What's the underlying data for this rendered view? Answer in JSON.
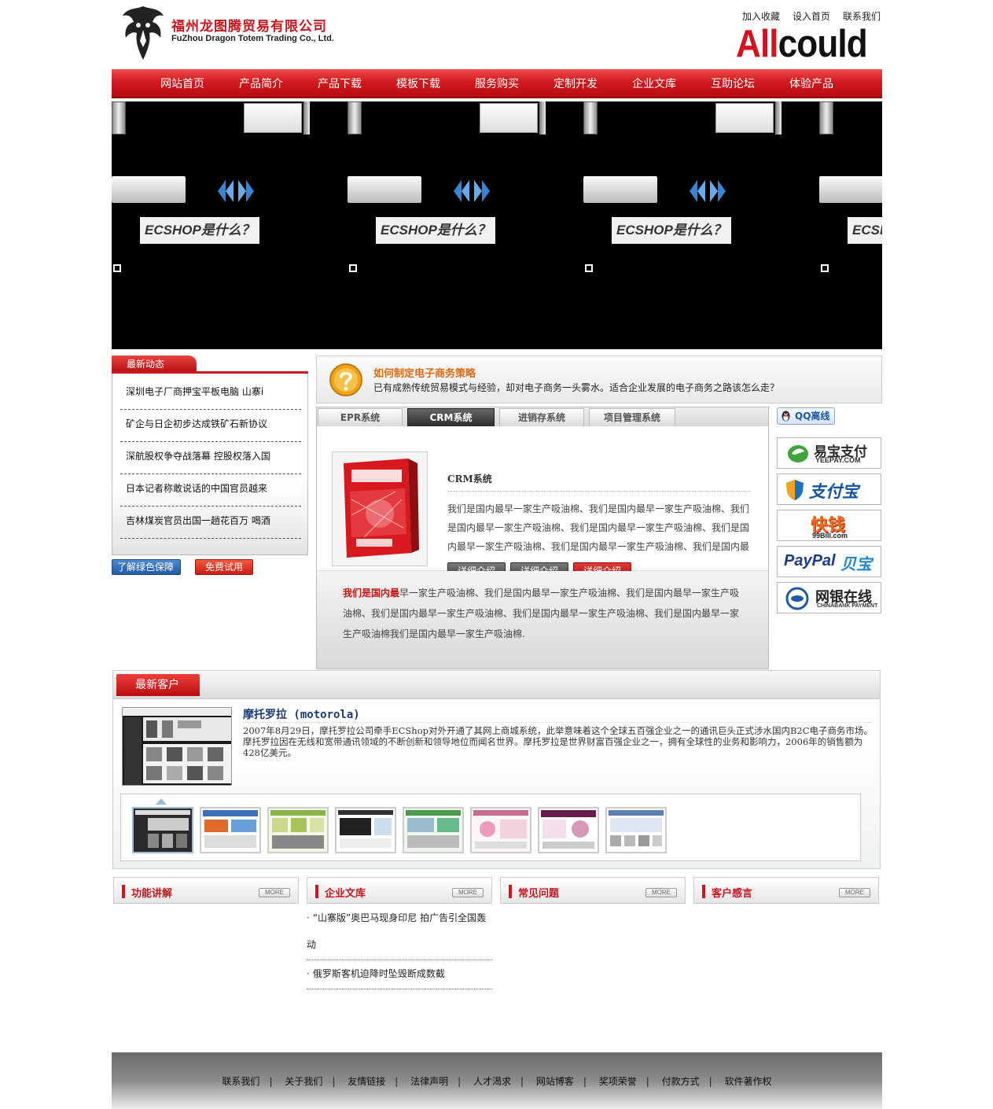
{
  "header": {
    "company_cn": "福州龙图腾贸易有限公司",
    "company_en": "FuZhou Dragon Totem Trading Co., Ltd.",
    "links": [
      "加入收藏",
      "设入首页",
      "联系我们"
    ],
    "brand_a": "All",
    "brand_b": "could"
  },
  "nav": [
    "网站首页",
    "产品简介",
    "产品下载",
    "模板下载",
    "服务购买",
    "定制开发",
    "企业文库",
    "互助论坛",
    "体验产品"
  ],
  "banner": {
    "label": "ECSHOP是什么？",
    "label_cut": "ECSI"
  },
  "news": {
    "tab": "最新动态",
    "items": [
      "深圳电子厂商押宝平板电脑 山寨i",
      "矿企与日企初步达成铁矿石新协议",
      "深航股权争夺战落幕 控股权落入国",
      "日本记者称敢说话的中国官员越来",
      "吉林煤炭官员出国一趟花百万 喝酒"
    ],
    "btn_green": "了解绿色保障",
    "btn_trial": "免费试用"
  },
  "strategy": {
    "title": "如何制定电子商务策略",
    "text": "已有成熟传统贸易模式与经验，却对电子商务一头雾水。适合企业发展的电子商务之路该怎么走？"
  },
  "tabs": {
    "labels": [
      "EPR系统",
      "CRM系统",
      "进销存系统",
      "项目管理系统"
    ],
    "product_title": "CRM系统",
    "product_desc": "我们是国内最早一家生产吸油棉、我们是国内最早一家生产吸油棉、我们是国内最早一家生产吸油棉、我们是国内最早一家生产吸油棉、我们是国内最早一家生产吸油棉、我们是国内最早一家生产吸油棉、我们是国内最",
    "buttons": [
      "详细介绍",
      "详细介绍",
      "详细介绍"
    ],
    "footer_bold": "我们是国内最",
    "footer_text": "早一家生产吸油棉、我们是国内最早一家生产吸油棉、我们是国内最早一家生产吸油棉、我们是国内最早一家生产吸油棉、我们是国内最早一家生产吸油棉、我们是国内最早一家生产吸油棉我们是国内最早一家生产吸油棉."
  },
  "payments": {
    "qq": "QQ离线",
    "yeepay": "易宝支付",
    "yeepay_en": "YEEPAY.COM",
    "alipay": "支付宝",
    "kuaiqian": "快钱",
    "kuaiqian_en": "99Bill.com",
    "paypal": "PayPal",
    "paypal_cn": "贝宝",
    "chinabank": "网银在线",
    "chinabank_en": "CHINABANK PAYMENT"
  },
  "clients": {
    "tab": "最新客户",
    "title": "摩托罗拉 (motorola)",
    "desc": "2007年8月29日，摩托罗拉公司牵手ECShop对外开通了其网上商城系统，此举意味着这个全球五百强企业之一的通讯巨头正式涉水国内B2C电子商务市场。摩托罗拉因在无线和宽带通讯领域的不断创新和领导地位而闻名世界。摩托罗拉是世界财富百强企业之一，拥有全球性的业务和影响力，2006年的销售额为428亿美元。"
  },
  "info_boxes": [
    {
      "title": "功能讲解",
      "more": "MORE"
    },
    {
      "title": "企业文库",
      "more": "MORE"
    },
    {
      "title": "常见问题",
      "more": "MORE"
    },
    {
      "title": "客户感言",
      "more": "MORE"
    }
  ],
  "library_items": [
    "“山寨版”奥巴马现身印尼 拍广告引全国轰动",
    "俄罗斯客机迫降时坠毁断成数截"
  ],
  "footer": [
    "联系我们",
    "关于我们",
    "友情链接",
    "法律声明",
    "人才渴求",
    "网站博客",
    "奖项荣誉",
    "付款方式",
    "软件著作权"
  ],
  "colors": {
    "brand_red": "#d2131b",
    "nav_red": "#c8161d",
    "footer_gray": "#7a7a7a"
  }
}
